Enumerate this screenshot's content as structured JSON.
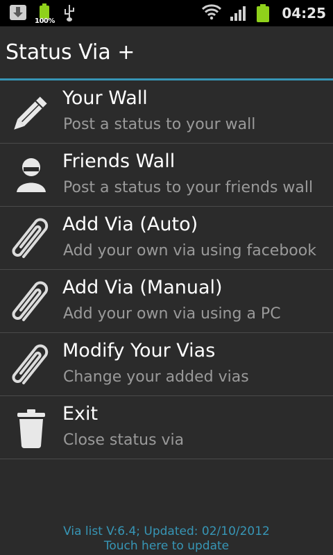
{
  "status_bar": {
    "battery_percent": "100%",
    "time": "04:25",
    "icons": [
      "download-icon",
      "battery-icon",
      "usb-icon",
      "wifi-icon",
      "signal-icon",
      "battery-icon"
    ],
    "signal_bars": 4,
    "accent_battery": "#8fd11b"
  },
  "app": {
    "title": "Status Via +",
    "accent": "#3796b6"
  },
  "menu": [
    {
      "title": "Your Wall",
      "subtitle": "Post a status to your wall",
      "icon": "pencil-icon"
    },
    {
      "title": "Friends Wall",
      "subtitle": "Post a status to your friends wall",
      "icon": "person-icon"
    },
    {
      "title": "Add Via (Auto)",
      "subtitle": "Add your own via using facebook",
      "icon": "paperclip-icon"
    },
    {
      "title": "Add Via (Manual)",
      "subtitle": "Add your own via using a PC",
      "icon": "paperclip-icon"
    },
    {
      "title": "Modify Your Vias",
      "subtitle": "Change your added vias",
      "icon": "paperclip-icon"
    },
    {
      "title": "Exit",
      "subtitle": "Close status via",
      "icon": "trash-icon"
    }
  ],
  "footer": {
    "version_line": "Via list V:6.4; Updated: 02/10/2012",
    "update_link": "Touch here to update"
  }
}
